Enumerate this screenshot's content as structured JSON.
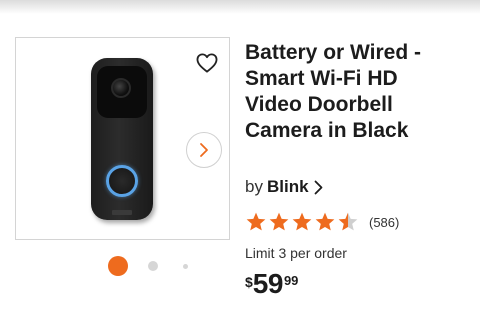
{
  "product": {
    "title_lines": [
      "Battery or Wired -",
      "Smart Wi-Fi HD",
      "Video Doorbell",
      "Camera in Black"
    ],
    "by_label": "by",
    "brand": "Blink",
    "rating_value": 4.5,
    "review_count": "(586)",
    "limit_text": "Limit 3 per order",
    "price": {
      "currency": "$",
      "dollars": "59",
      "cents": "99"
    }
  },
  "gallery": {
    "total_images": 3,
    "active_index": 0
  },
  "icons": {
    "favorite": "heart-icon",
    "next": "chevron-right-icon",
    "brand_arrow": "chevron-right-icon"
  },
  "colors": {
    "accent": "#ee6b1e",
    "star_filled": "#ee6b1e",
    "star_empty": "#cfcfcf",
    "doorbell_ring": "#5aa3e6"
  }
}
